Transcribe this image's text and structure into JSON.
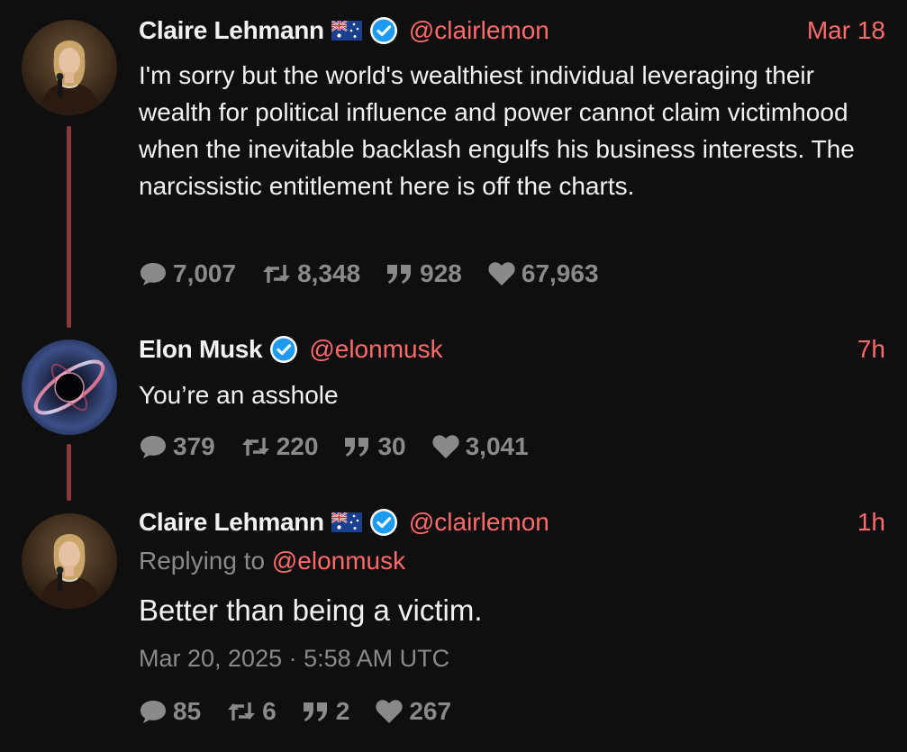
{
  "colors": {
    "background": "#0f0f0f",
    "text": "#f2f2f2",
    "muted": "#8a8a8a",
    "accent": "#ff6b6b",
    "thread_line": "#8a3a3a",
    "verified": "#1d9bf0"
  },
  "tweets": [
    {
      "name": "Claire Lehmann",
      "flag": "australia-flag",
      "verified": true,
      "handle": "@clairlemon",
      "date": "Mar 18",
      "text": "I'm sorry but the world's wealthiest individual leveraging their wealth for political influence and power cannot claim victimhood when the inevitable backlash engulfs his business interests. The narcissistic entitlement here is off the charts.",
      "stats": {
        "replies": "7,007",
        "retweets": "8,348",
        "quotes": "928",
        "likes": "67,963"
      }
    },
    {
      "name": "Elon Musk",
      "verified": true,
      "handle": "@elonmusk",
      "date": "7h",
      "text": "You’re an asshole",
      "stats": {
        "replies": "379",
        "retweets": "220",
        "quotes": "30",
        "likes": "3,041"
      }
    },
    {
      "name": "Claire Lehmann",
      "flag": "australia-flag",
      "verified": true,
      "handle": "@clairlemon",
      "date": "1h",
      "replying_prefix": "Replying to",
      "replying_handle": "@elonmusk",
      "text": "Better than being a victim.",
      "timestamp": "Mar 20, 2025 · 5:58 AM UTC",
      "stats": {
        "replies": "85",
        "retweets": "6",
        "quotes": "2",
        "likes": "267"
      }
    }
  ]
}
